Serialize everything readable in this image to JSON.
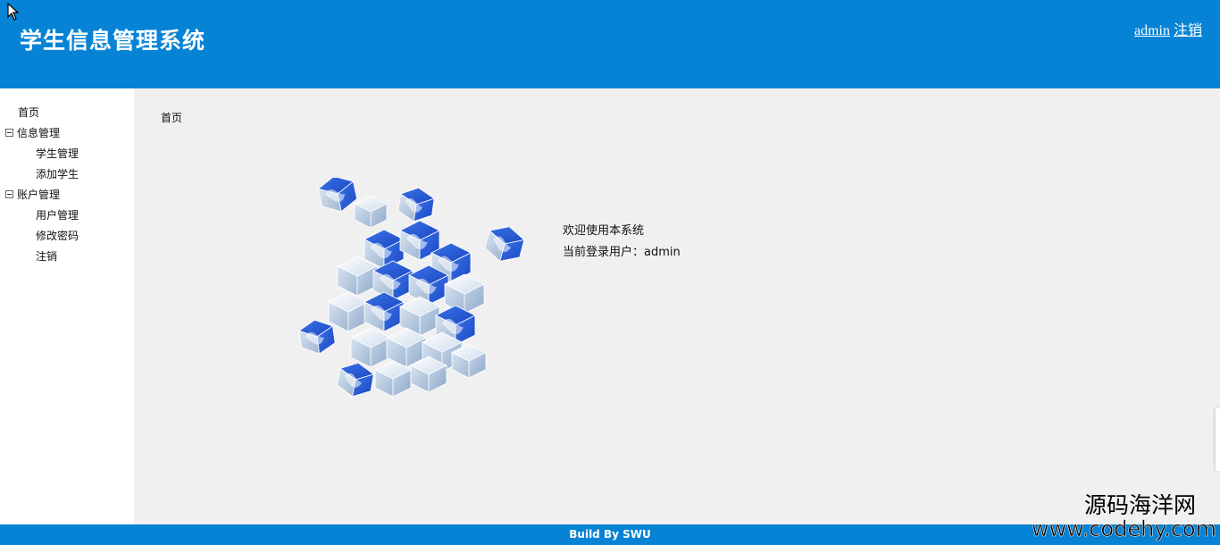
{
  "header": {
    "title": "学生信息管理系统",
    "user_link": "admin",
    "logout_link": "注销"
  },
  "sidebar": {
    "items": [
      {
        "label": "首页"
      },
      {
        "label": "信息管理",
        "children": [
          {
            "label": "学生管理"
          },
          {
            "label": "添加学生"
          }
        ]
      },
      {
        "label": "账户管理",
        "children": [
          {
            "label": "用户管理"
          },
          {
            "label": "修改密码"
          },
          {
            "label": "注销"
          }
        ]
      }
    ]
  },
  "main": {
    "breadcrumb": "首页",
    "welcome": "欢迎使用本系统",
    "current_user": "当前登录用户：admin"
  },
  "footer": {
    "text": "Build By SWU"
  },
  "watermark": {
    "name": "源码海洋网",
    "url": "www.codehy.com"
  },
  "colors": {
    "brand_blue": "#0783d5",
    "content_bg": "#f0f0f0"
  }
}
